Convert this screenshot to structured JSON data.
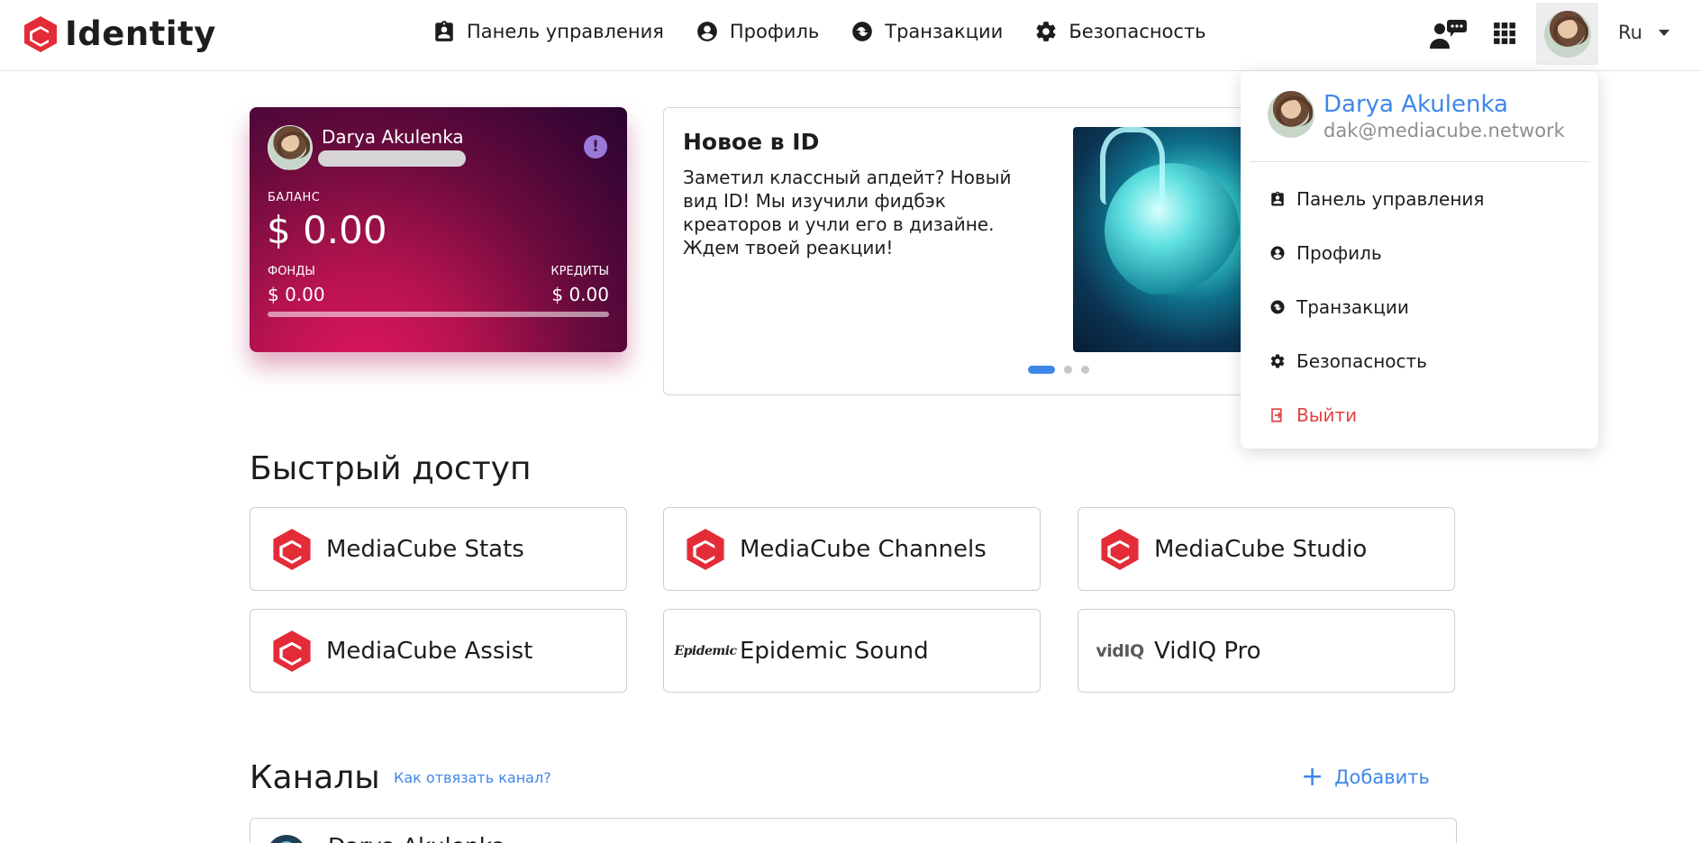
{
  "brand": {
    "name": "Identity",
    "accent": "#e42b38"
  },
  "nav": {
    "items": [
      {
        "label": "Панель управления",
        "icon": "dashboard-icon"
      },
      {
        "label": "Профиль",
        "icon": "profile-icon"
      },
      {
        "label": "Транзакции",
        "icon": "transactions-icon"
      },
      {
        "label": "Безопасность",
        "icon": "gear-icon"
      }
    ]
  },
  "header": {
    "language": "Ru"
  },
  "balance_card": {
    "name": "Darya Akulenka",
    "balance_label": "БАЛАНС",
    "balance_value": "$ 0.00",
    "funds_label": "ФОНДЫ",
    "funds_value": "$ 0.00",
    "credits_label": "КРЕДИТЫ",
    "credits_value": "$ 0.00",
    "progress": 0
  },
  "news": {
    "title": "Новое в ID",
    "text": "Заметил классный апдейт? Новый вид ID! Мы изучили фидбэк креаторов и учли его в дизайне. Ждем твоей реакции!",
    "slides_total": 3,
    "active_slide": 1
  },
  "dropdown": {
    "name": "Darya Akulenka",
    "email": "dak@mediacube.network",
    "items": [
      {
        "label": "Панель управления",
        "icon": "dashboard-icon"
      },
      {
        "label": "Профиль",
        "icon": "profile-icon"
      },
      {
        "label": "Транзакции",
        "icon": "transactions-icon"
      },
      {
        "label": "Безопасность",
        "icon": "gear-icon"
      }
    ],
    "logout": "Выйти"
  },
  "quick_access": {
    "title": "Быстрый доступ",
    "tiles": [
      {
        "label": "MediaCube Stats",
        "icon": "mediacube-icon"
      },
      {
        "label": "MediaCube Channels",
        "icon": "mediacube-icon"
      },
      {
        "label": "MediaCube Studio",
        "icon": "mediacube-icon"
      },
      {
        "label": "MediaCube Assist",
        "icon": "mediacube-icon"
      },
      {
        "label": "Epidemic Sound",
        "icon": "epidemic-icon",
        "icon_text": "Epidemic"
      },
      {
        "label": "VidIQ Pro",
        "icon": "vidiq-icon",
        "icon_text": "vidIQ"
      }
    ]
  },
  "channels": {
    "title": "Каналы",
    "help_link": "Как отвязать канал?",
    "add_label": "Добавить",
    "first_channel": "Darya Akulenka"
  }
}
